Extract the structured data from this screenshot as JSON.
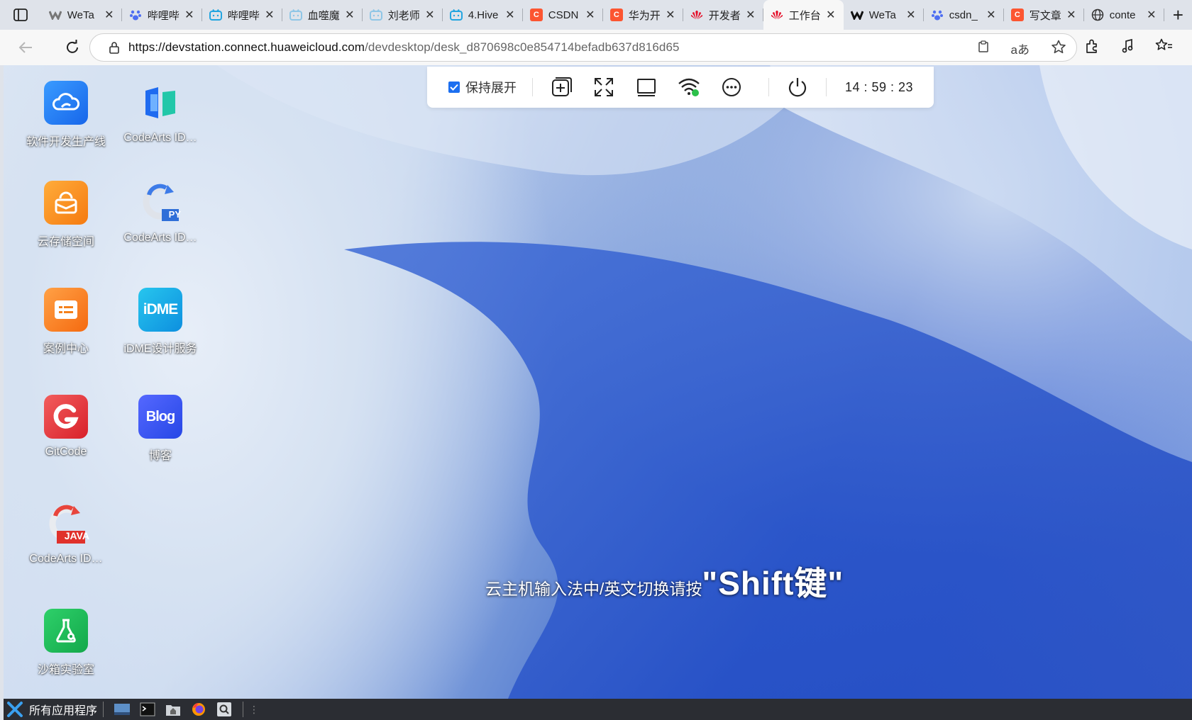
{
  "browser": {
    "tabs": [
      {
        "title": "WeTa",
        "favicon": "wetab-icon",
        "active": false
      },
      {
        "title": "哔哩哔",
        "favicon": "baidu-paw-icon",
        "active": false
      },
      {
        "title": "哔哩哔",
        "favicon": "bilibili-icon",
        "active": false
      },
      {
        "title": "血噬魔",
        "favicon": "bilibili-icon",
        "active": false
      },
      {
        "title": "刘老师",
        "favicon": "bilibili-icon",
        "active": false
      },
      {
        "title": "4.Hive",
        "favicon": "bilibili-icon",
        "active": false
      },
      {
        "title": "CSDN",
        "favicon": "csdn-icon",
        "active": false
      },
      {
        "title": "华为开",
        "favicon": "csdn-icon",
        "active": false
      },
      {
        "title": "开发者",
        "favicon": "huawei-icon",
        "active": false
      },
      {
        "title": "工作台",
        "favicon": "huawei-icon",
        "active": true
      },
      {
        "title": "WeTa",
        "favicon": "wetab-icon",
        "active": false
      },
      {
        "title": "csdn_",
        "favicon": "baidu-paw-icon",
        "active": false
      },
      {
        "title": "写文章",
        "favicon": "csdn-icon",
        "active": false
      },
      {
        "title": "conte",
        "favicon": "globe-icon",
        "active": false
      }
    ],
    "new_tab": "+",
    "url_host": "https://devstation.connect.huaweicloud.com",
    "url_path": "/devdesktop/desk_d870698c0e854714befadb637d816d65"
  },
  "toolbar": {
    "keep_expanded": "保持展开",
    "time": "14 : 59 : 23"
  },
  "desktop_icons": [
    {
      "label": "软件开发生产线",
      "icon": "cloud-dev-icon"
    },
    {
      "label": "CodeArts ID…",
      "icon": "codearts-ide-icon"
    },
    {
      "label": "云存储空间",
      "icon": "cloud-storage-icon"
    },
    {
      "label": "CodeArts ID…",
      "icon": "codearts-python-icon"
    },
    {
      "label": "案例中心",
      "icon": "case-center-icon"
    },
    {
      "label": "iDME设计服务",
      "icon": "idme-icon"
    },
    {
      "label": "GitCode",
      "icon": "gitcode-icon"
    },
    {
      "label": "博客",
      "icon": "blog-icon"
    },
    {
      "label": "CodeArts ID…",
      "icon": "codearts-java-icon"
    },
    {
      "label": "沙箱实验室",
      "icon": "sandbox-lab-icon"
    }
  ],
  "icon_badges": {
    "py": "PY",
    "java": "JAVA",
    "idme": "iDME",
    "blog": "Blog"
  },
  "hint": {
    "prefix": "云主机输入法中/英文切换请按",
    "key": "\"Shift键\""
  },
  "taskbar": {
    "start_label": "所有应用程序"
  },
  "colors": {
    "accent": "#1c6ff0",
    "taskbar": "#2b2d33"
  }
}
